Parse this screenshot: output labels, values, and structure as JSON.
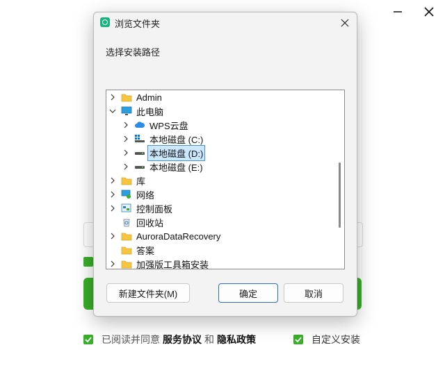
{
  "window": {
    "minimize_label": "",
    "close_label": ""
  },
  "installer": {
    "agree_prefix": "已阅读并同意",
    "service_agreement": "服务协议",
    "and": "和",
    "privacy_policy": "隐私政策",
    "custom_install": "自定义安装"
  },
  "dialog": {
    "title": "浏览文件夹",
    "prompt": "选择安装路径",
    "tree": [
      {
        "label": "Admin",
        "icon": "folder-icon",
        "expand": "collapsed",
        "level": 0
      },
      {
        "label": "此电脑",
        "icon": "computer-icon",
        "expand": "expanded",
        "level": 0
      },
      {
        "label": "WPS云盘",
        "icon": "cloud-icon",
        "expand": "collapsed",
        "level": 1
      },
      {
        "label": "本地磁盘 (C:)",
        "icon": "system-drive-icon",
        "expand": "collapsed",
        "level": 1
      },
      {
        "label": "本地磁盘 (D:)",
        "icon": "drive-icon",
        "expand": "collapsed",
        "level": 1,
        "selected": true
      },
      {
        "label": "本地磁盘 (E:)",
        "icon": "drive-icon",
        "expand": "collapsed",
        "level": 1
      },
      {
        "label": "库",
        "icon": "folder-icon",
        "expand": "collapsed",
        "level": 0
      },
      {
        "label": "网络",
        "icon": "network-icon",
        "expand": "collapsed",
        "level": 0
      },
      {
        "label": "控制面板",
        "icon": "control-panel-icon",
        "expand": "collapsed",
        "level": 0
      },
      {
        "label": "回收站",
        "icon": "recycle-bin-icon",
        "expand": "none",
        "level": 0
      },
      {
        "label": "AuroraDataRecovery",
        "icon": "folder-icon",
        "expand": "collapsed",
        "level": 0
      },
      {
        "label": "答案",
        "icon": "folder-icon",
        "expand": "none",
        "level": 0
      },
      {
        "label": "加强版工具箱安装",
        "icon": "folder-icon",
        "expand": "collapsed",
        "level": 0
      }
    ],
    "new_folder_label": "新建文件夹(M)",
    "ok_label": "确定",
    "cancel_label": "取消"
  },
  "colors": {
    "accent_green": "#3aae2a",
    "selection": "#cce8ff",
    "focus_border": "#2a6dc4"
  }
}
